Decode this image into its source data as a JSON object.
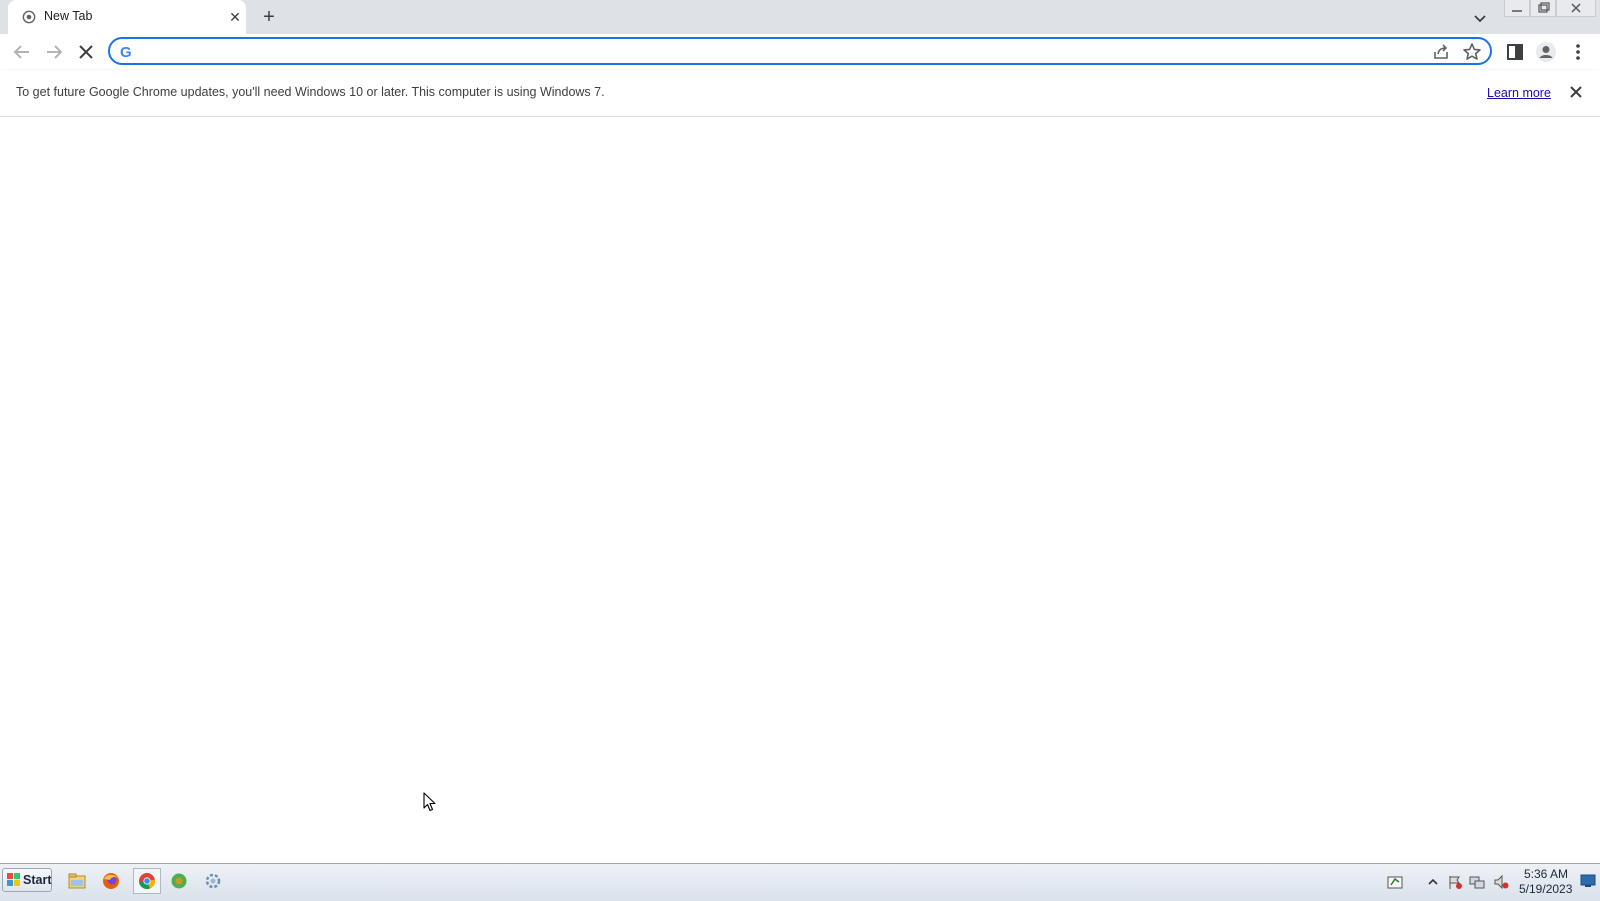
{
  "browser": {
    "tab": {
      "title": "New Tab"
    },
    "omnibox": {
      "value": "",
      "placeholder": ""
    },
    "infobar": {
      "message": "To get future Google Chrome updates, you'll need Windows 10 or later. This computer is using Windows 7.",
      "link_label": "Learn more"
    }
  },
  "taskbar": {
    "start_label": "Start",
    "clock": {
      "time": "5:36 AM",
      "date": "5/19/2023"
    }
  },
  "icons": {
    "new_tab": "+",
    "tab_close": "✕",
    "search_engine_logo": "G"
  },
  "colors": {
    "accent": "#1a73e8",
    "tabstrip": "#dee1e6",
    "link": "#1a0dab"
  }
}
